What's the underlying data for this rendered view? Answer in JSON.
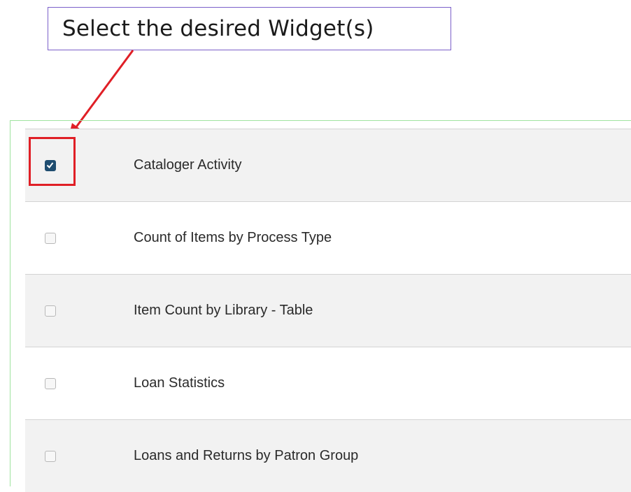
{
  "callout": {
    "text": "Select the desired Widget(s)"
  },
  "widgets": [
    {
      "label": "Cataloger Activity",
      "checked": true
    },
    {
      "label": "Count of Items by Process Type",
      "checked": false
    },
    {
      "label": "Item Count by Library - Table",
      "checked": false
    },
    {
      "label": "Loan Statistics",
      "checked": false
    },
    {
      "label": "Loans and Returns by Patron Group",
      "checked": false
    }
  ],
  "colors": {
    "annotation_red": "#e01f26",
    "callout_border": "#7b5fc9",
    "checkbox_checked": "#1f4d70",
    "row_alt": "#f2f2f2"
  }
}
